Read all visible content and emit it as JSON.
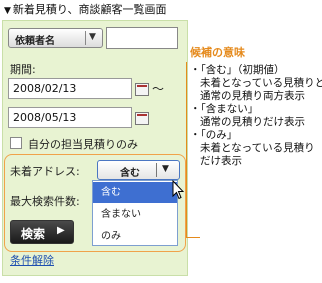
{
  "header": {
    "title": "新着見積り、商談顧客一覧画面",
    "collapse_icon": "triangle-down"
  },
  "form": {
    "staff_select": "依頼者名",
    "period_label": "期間:",
    "date_from": "2008/02/13",
    "date_to": "2008/05/13",
    "tilde": "～",
    "only_mine_label": "自分の担当見積りのみ",
    "unarrived_label": "未着アドレス:",
    "unarrived_value": "含む",
    "dropdown_options": [
      "含む",
      "含まない",
      "のみ"
    ],
    "max_count_label": "最大検索件数:",
    "search_button": "検索",
    "reset_link": "条件解除"
  },
  "notes": {
    "title": "候補の意味",
    "lines": [
      "・「含む」（初期値）",
      "未着となっている見積りと",
      "通常の見積り両方表示",
      "・「含まない」",
      "通常の見積りだけ表示",
      "・「のみ」",
      "未着となっている見積り",
      "だけ表示"
    ]
  },
  "colors": {
    "accent_orange": "#e58a1c",
    "panel_green": "#e8f3d2",
    "selected_blue": "#3e6fd1"
  }
}
